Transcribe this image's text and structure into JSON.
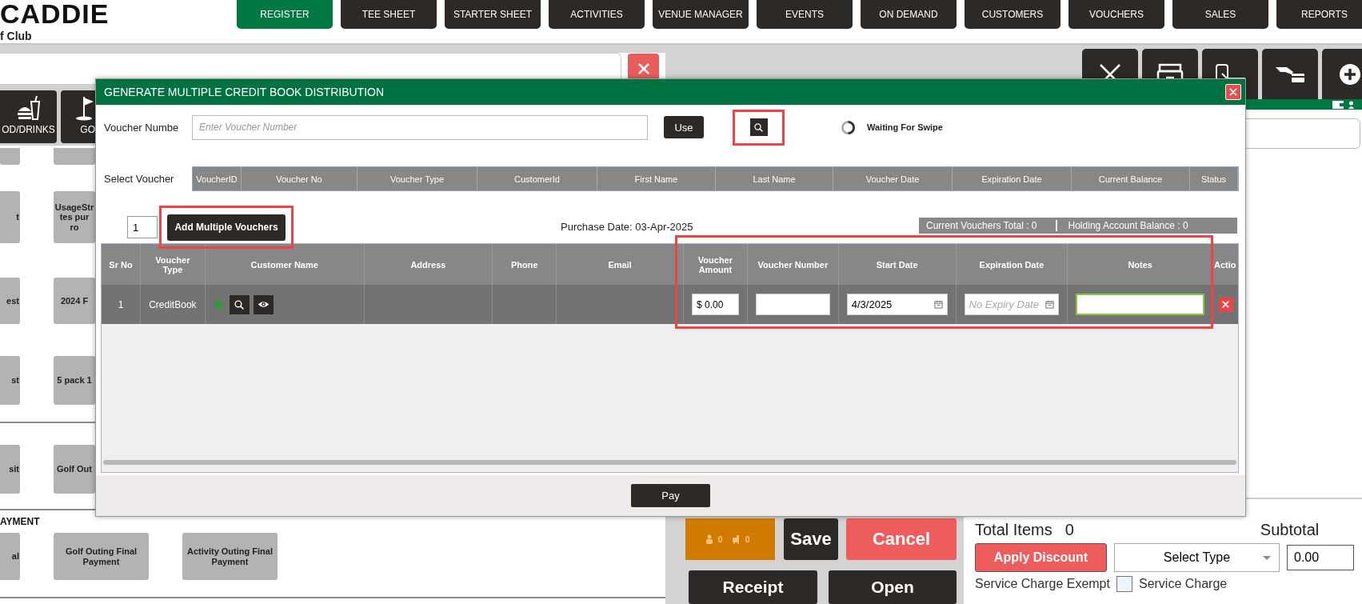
{
  "header": {
    "logo": "CADDIE",
    "club": "f Club"
  },
  "nav_tabs": [
    {
      "label": "REGISTER",
      "selected": true
    },
    {
      "label": "TEE SHEET",
      "selected": false
    },
    {
      "label": "STARTER SHEET",
      "selected": false
    },
    {
      "label": "ACTIVITIES",
      "selected": false
    },
    {
      "label": "VENUE MANAGER",
      "selected": false
    },
    {
      "label": "EVENTS",
      "selected": false
    },
    {
      "label": "ON DEMAND",
      "selected": false
    },
    {
      "label": "CUSTOMERS",
      "selected": false
    },
    {
      "label": "VOUCHERS",
      "selected": false
    },
    {
      "label": "SALES",
      "selected": false
    },
    {
      "label": "REPORTS",
      "selected": false
    }
  ],
  "register": {
    "categories": [
      {
        "label": "OD/DRINKS",
        "kind": "food"
      },
      {
        "label": "GO",
        "kind": "golf"
      }
    ],
    "groups": [
      {
        "rows": [
          {
            "tiles": [
              "t",
              "UsageStr\ntes pur\nro"
            ]
          },
          {
            "tiles": [
              "est",
              "2024 F"
            ]
          },
          {
            "tiles": [
              "st",
              "5 pack 1"
            ]
          }
        ]
      },
      {
        "rows": [
          {
            "tiles": [
              "sit",
              "Golf Out"
            ]
          }
        ]
      },
      {
        "title": "AYMENT",
        "rows": [
          {
            "tiles": [
              "al",
              "Golf Outing Final Payment",
              "Activity Outing Final Payment"
            ]
          }
        ]
      }
    ]
  },
  "order": {
    "counters": [
      "0",
      "0"
    ],
    "save_button": "Save",
    "cancel_button": "Cancel",
    "receipt_button": "Receipt",
    "open_button": "Open",
    "total_items_label": "Total Items",
    "total_items": "0",
    "subtotal_label": "Subtotal",
    "discount_button": "Apply Discount",
    "discount_type": "Select Type",
    "discount_amount": "0.00",
    "service_charge_exempt": {
      "label": "Service Charge Exempt",
      "checked": false
    },
    "service_charge_label": "Service Charge"
  },
  "modal": {
    "title": "GENERATE MULTIPLE CREDIT BOOK DISTRIBUTION",
    "voucher_label": "Voucher Numbe",
    "voucher_field": {
      "placeholder": "Enter Voucher Number"
    },
    "use_button": "Use",
    "search_button": {
      "highlighted": true
    },
    "swipe_status": "Waiting For Swipe",
    "select_voucher_label": "Select Voucher",
    "voucher_columns": [
      "VoucherID",
      "Voucher No",
      "Voucher Type",
      "CustomerId",
      "First Name",
      "Last Name",
      "Voucher Date",
      "Expiration Date",
      "Current Balance",
      "Status"
    ],
    "quantity": "1",
    "add_button": {
      "label": "Add Multiple Vouchers",
      "highlighted": true
    },
    "purchase_date": "Purchase Date: 03-Apr-2025",
    "current_total": "Current Vouchers Total : 0",
    "holding_balance": "Holding Account Balance : 0",
    "table": {
      "columns": [
        {
          "label": "Sr No",
          "highlighted": false
        },
        {
          "label": "Voucher Type",
          "highlighted": false
        },
        {
          "label": "Customer Name",
          "highlighted": false
        },
        {
          "label": "Address",
          "highlighted": false
        },
        {
          "label": "Phone",
          "highlighted": false
        },
        {
          "label": "Email",
          "highlighted": false
        },
        {
          "label": "Voucher Amount",
          "highlighted": true
        },
        {
          "label": "Voucher Number",
          "highlighted": true
        },
        {
          "label": "Start Date",
          "highlighted": true
        },
        {
          "label": "Expiration Date",
          "highlighted": true
        },
        {
          "label": "Notes",
          "highlighted": true
        },
        {
          "label": "Actio",
          "highlighted": false
        }
      ],
      "rows": [
        {
          "cells": [
            {
              "kind": "text",
              "text": "1"
            },
            {
              "kind": "text",
              "text": "CreditBook"
            },
            {
              "kind": "customer_actions"
            },
            {
              "kind": "empty"
            },
            {
              "kind": "empty"
            },
            {
              "kind": "empty"
            },
            {
              "kind": "field",
              "value": "$ 0.00",
              "focused": false
            },
            {
              "kind": "field",
              "focused": false
            },
            {
              "kind": "date",
              "value": "4/3/2025",
              "focused": false
            },
            {
              "kind": "date",
              "placeholder": "No Expiry Date",
              "focused": false
            },
            {
              "kind": "field",
              "focused": true
            },
            {
              "kind": "delete"
            }
          ]
        }
      ]
    },
    "pay_button": "Pay"
  }
}
